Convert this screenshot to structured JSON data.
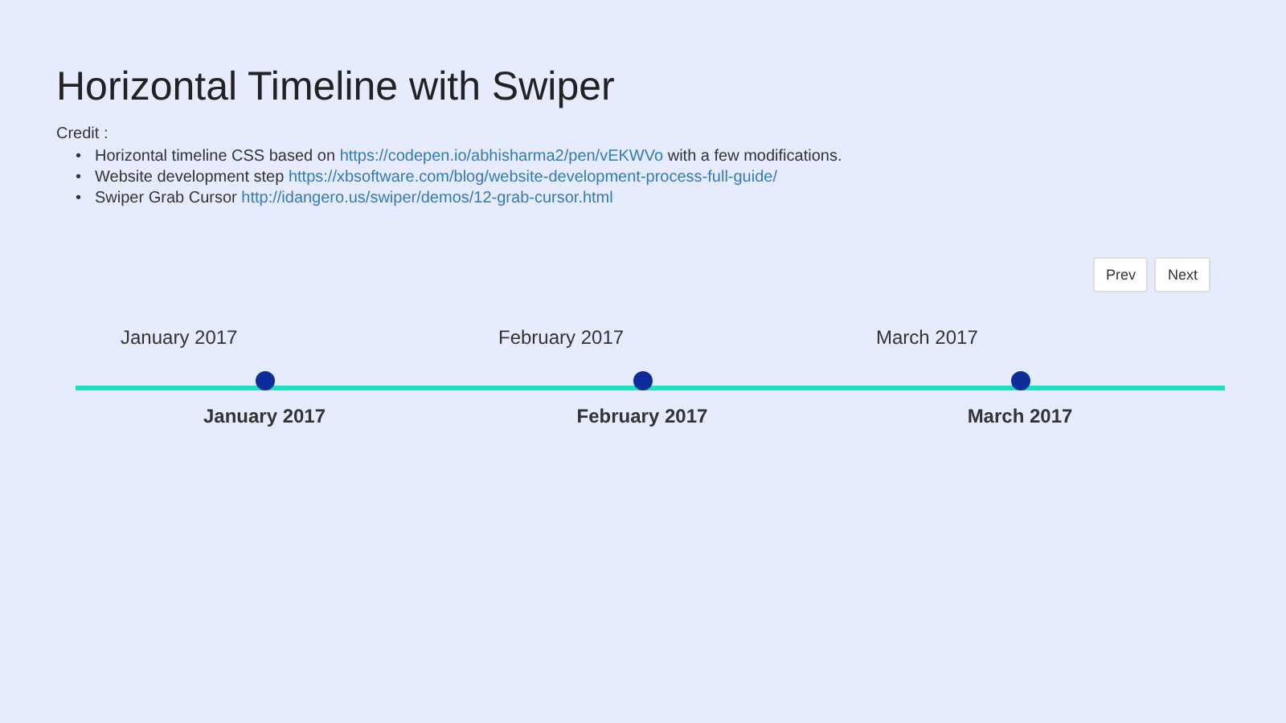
{
  "title": "Horizontal Timeline with Swiper",
  "credit_label": "Credit :",
  "credits": [
    {
      "marker": "•",
      "text": "Horizontal timeline CSS based on ",
      "link": "https://codepen.io/abhisharma2/pen/vEKWVo",
      "after": " with a few modifications."
    },
    {
      "marker": "•",
      "text": "Website development step ",
      "link": "https://xbsoftware.com/blog/website-development-process-full-guide/"
    },
    {
      "marker": "•",
      "text": "Swiper Grab Cursor ",
      "link": "http://idangero.us/swiper/demos/12-grab-cursor.html"
    }
  ],
  "buttons": [
    "Prev",
    "Next"
  ],
  "slides": [
    {
      "top": "January 2017",
      "bottom": "January 2017"
    },
    {
      "top": "February 2017",
      "bottom": "February 2017"
    },
    {
      "top": "March 2017",
      "bottom": "March 2017"
    }
  ]
}
